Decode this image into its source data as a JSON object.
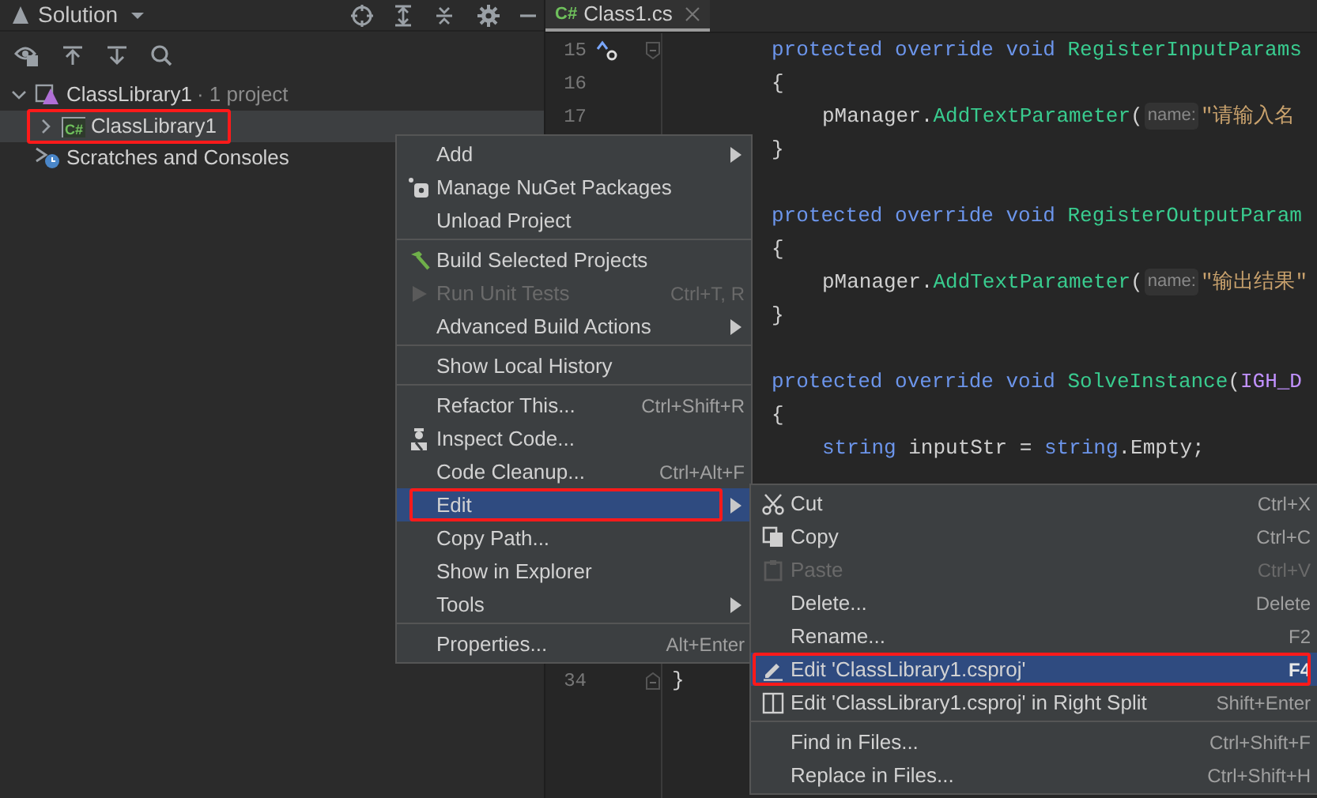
{
  "solution_panel": {
    "title": "Solution",
    "tree": [
      {
        "label": "ClassLibrary1",
        "note": "· 1 project",
        "kind": "solution",
        "expanded": true,
        "selected": false,
        "outlined": false,
        "children": [
          {
            "label": "ClassLibrary1",
            "badge": "C#",
            "kind": "project",
            "expanded": false,
            "selected": true,
            "outlined": true
          }
        ]
      },
      {
        "label": "Scratches and Consoles",
        "kind": "scratches",
        "selected": false,
        "outlined": false
      }
    ]
  },
  "editor": {
    "tabs": [
      {
        "label": "Class1.cs",
        "badge": "C#",
        "selected": true
      }
    ],
    "methods": [
      {
        "header": {
          "number": "15",
          "marker": true,
          "fold_marker": true,
          "segments": [
            {
              "kind": "keyword",
              "text": "protected override void "
            },
            {
              "kind": "method",
              "text": "RegisterInputParams"
            }
          ]
        },
        "open": {
          "number": "16",
          "marker": false,
          "segments": [
            {
              "kind": "plain",
              "text": "{"
            }
          ]
        },
        "body": [
          {
            "number": "17",
            "marker": false,
            "segments": [
              {
                "kind": "plain",
                "text": "pManager."
              },
              {
                "kind": "method",
                "text": "AddTextParameter"
              },
              {
                "kind": "plain",
                "text": "("
              },
              {
                "kind": "hint",
                "text": "name:"
              },
              {
                "kind": "string",
                "text": "\"请输入名"
              }
            ]
          }
        ],
        "close": {
          "segments": [
            {
              "kind": "plain",
              "text": "}"
            }
          ]
        }
      },
      {
        "header": {
          "segments": [
            {
              "kind": "keyword",
              "text": "protected override void "
            },
            {
              "kind": "method",
              "text": "RegisterOutputParam"
            }
          ]
        },
        "open": {
          "segments": [
            {
              "kind": "plain",
              "text": "{"
            }
          ]
        },
        "body": [
          {
            "segments": [
              {
                "kind": "plain",
                "text": "pManager."
              },
              {
                "kind": "method",
                "text": "AddTextParameter"
              },
              {
                "kind": "plain",
                "text": "("
              },
              {
                "kind": "hint",
                "text": "name:"
              },
              {
                "kind": "string",
                "text": "\"输出结果\""
              }
            ]
          }
        ],
        "close": {
          "segments": [
            {
              "kind": "plain",
              "text": "}"
            }
          ]
        }
      },
      {
        "header": {
          "segments": [
            {
              "kind": "keyword",
              "text": "protected override void "
            },
            {
              "kind": "method",
              "text": "SolveInstance"
            },
            {
              "kind": "plain",
              "text": "("
            },
            {
              "kind": "type",
              "text": "IGH_D"
            }
          ]
        },
        "open": {
          "segments": [
            {
              "kind": "plain",
              "text": "{"
            }
          ]
        },
        "body": [
          {
            "segments": [
              {
                "kind": "keyword",
                "text": "string "
              },
              {
                "kind": "plain",
                "text": "inputStr = "
              },
              {
                "kind": "keyword",
                "text": "string"
              },
              {
                "kind": "plain",
                "text": ".Empty;"
              }
            ]
          }
        ]
      }
    ],
    "closing_line": {
      "number": "34",
      "marker": false,
      "fold_marker": true,
      "segments": [
        {
          "kind": "plain",
          "text": "}"
        }
      ]
    }
  },
  "context_menu": {
    "items": [
      {
        "label": "Add",
        "has_submenu": true,
        "disabled": false,
        "selected": false,
        "outlined": false
      },
      {
        "label": "Manage NuGet Packages",
        "disabled": false,
        "selected": false,
        "outlined": false
      },
      {
        "label": "Unload Project",
        "disabled": false,
        "selected": false,
        "outlined": false
      },
      {
        "label": "Build Selected Projects",
        "separator_before": true,
        "disabled": false,
        "selected": false,
        "outlined": false
      },
      {
        "label": "Run Unit Tests",
        "shortcut": "Ctrl+T, R",
        "disabled": true,
        "selected": false,
        "outlined": false
      },
      {
        "label": "Advanced Build Actions",
        "has_submenu": true,
        "disabled": false,
        "selected": false,
        "outlined": false
      },
      {
        "label": "Show Local History",
        "separator_before": true,
        "disabled": false,
        "selected": false,
        "outlined": false
      },
      {
        "label": "Refactor This...",
        "shortcut": "Ctrl+Shift+R",
        "separator_before": true,
        "disabled": false,
        "selected": false,
        "outlined": false
      },
      {
        "label": "Inspect Code...",
        "disabled": false,
        "selected": false,
        "outlined": false
      },
      {
        "label": "Code Cleanup...",
        "shortcut": "Ctrl+Alt+F",
        "disabled": false,
        "selected": false,
        "outlined": false
      },
      {
        "label": "Edit",
        "has_submenu": true,
        "disabled": false,
        "selected": true,
        "outlined": true
      },
      {
        "label": "Copy Path...",
        "disabled": false,
        "selected": false,
        "outlined": false
      },
      {
        "label": "Show in Explorer",
        "disabled": false,
        "selected": false,
        "outlined": false
      },
      {
        "label": "Tools",
        "has_submenu": true,
        "disabled": false,
        "selected": false,
        "outlined": false
      },
      {
        "label": "Properties...",
        "shortcut": "Alt+Enter",
        "separator_before": true,
        "disabled": false,
        "selected": false,
        "outlined": false
      }
    ]
  },
  "submenu": {
    "items": [
      {
        "label": "Cut",
        "shortcut": "Ctrl+X",
        "disabled": false,
        "selected": false,
        "outlined": false
      },
      {
        "label": "Copy",
        "shortcut": "Ctrl+C",
        "disabled": false,
        "selected": false,
        "outlined": false
      },
      {
        "label": "Paste",
        "shortcut": "Ctrl+V",
        "disabled": true,
        "selected": false,
        "outlined": false
      },
      {
        "label": "Delete...",
        "shortcut": "Delete",
        "disabled": false,
        "selected": false,
        "outlined": false
      },
      {
        "label": "Rename...",
        "shortcut": "F2",
        "disabled": false,
        "selected": false,
        "outlined": false
      },
      {
        "label": "Edit 'ClassLibrary1.csproj'",
        "shortcut": "F4",
        "disabled": false,
        "selected": true,
        "outlined": true
      },
      {
        "label": "Edit 'ClassLibrary1.csproj' in Right Split",
        "shortcut": "Shift+Enter",
        "disabled": false,
        "selected": false,
        "outlined": false
      },
      {
        "label": "Find in Files...",
        "shortcut": "Ctrl+Shift+F",
        "separator_before": true,
        "disabled": false,
        "selected": false,
        "outlined": false
      },
      {
        "label": "Replace in Files...",
        "shortcut": "Ctrl+Shift+H",
        "disabled": false,
        "selected": false,
        "outlined": false
      }
    ]
  }
}
